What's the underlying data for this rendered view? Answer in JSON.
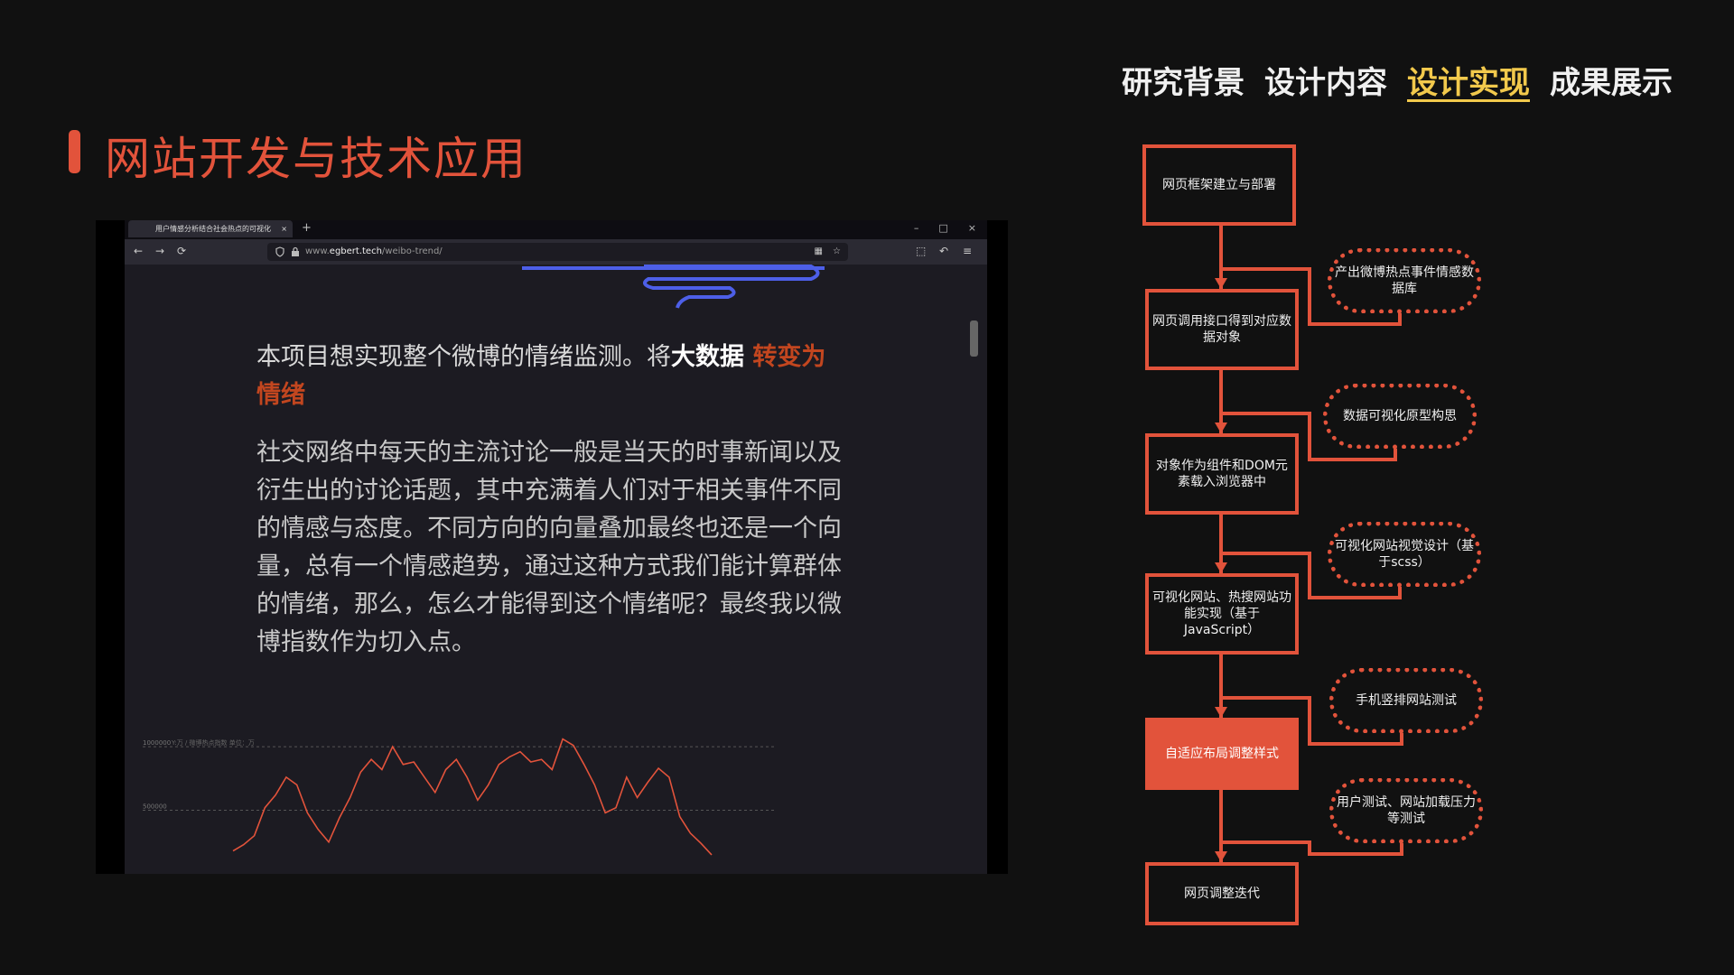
{
  "nav": [
    "研究背景",
    "设计内容",
    "设计实现",
    "成果展示"
  ],
  "nav_active_index": 2,
  "accent_color": "#e2533b",
  "active_nav_color": "#f2c94c",
  "page_title": "网站开发与技术应用",
  "browser": {
    "tab_title": "用户情感分析结合社会热点的可视化",
    "tab_close": "×",
    "new_tab": "+",
    "window_controls": [
      "–",
      "□",
      "×"
    ],
    "nav_icons": [
      "←",
      "→",
      "⟳"
    ],
    "url_prefix": "www.",
    "url_domain": "egbert.tech",
    "url_path": "/weibo-trend/",
    "right_icons": [
      "▦",
      "☆",
      "⬚",
      "↶",
      "≡"
    ]
  },
  "article": {
    "lead_plain": "本项目想实现整个微博的情绪监测。将",
    "lead_bold": "大数据",
    "lead_hot": " 转变为情绪",
    "body": "社交网络中每天的主流讨论一般是当天的时事新闻以及衍生出的讨论话题，其中充满着人们对于相关事件不同的情感与态度。不同方向的向量叠加最终也还是一个向量，总有一个情感趋势，通过这种方式我们能计算群体的情绪，那么，怎么才能得到这个情绪呢？最终我以微博指数作为切入点。"
  },
  "chart_data": {
    "type": "line",
    "title": "",
    "ylabel": "",
    "y_tick_labels": [
      "1000000",
      "500000"
    ],
    "y_series_label": "Y:万 / 微博热点指数 单位：万",
    "values": [
      180000,
      230000,
      300000,
      520000,
      620000,
      760000,
      700000,
      480000,
      350000,
      250000,
      440000,
      600000,
      800000,
      900000,
      820000,
      1000000,
      860000,
      880000,
      760000,
      640000,
      820000,
      900000,
      760000,
      580000,
      700000,
      860000,
      920000,
      960000,
      880000,
      900000,
      820000,
      1060000,
      1010000,
      860000,
      700000,
      480000,
      520000,
      760000,
      600000,
      720000,
      830000,
      760000,
      450000,
      320000,
      240000,
      150000
    ],
    "ylim": [
      0,
      1100000
    ],
    "grid": true
  },
  "flow": {
    "steps": [
      "网页框架建立与部署",
      "网页调用接口得到对应数据对象",
      "对象作为组件和DOM元素载入浏览器中",
      "可视化网站、热搜网站功能实现（基于JavaScript）",
      "自适应布局调整样式",
      "网页调整迭代"
    ],
    "side_notes": [
      "产出微博热点事件情感数据库",
      "数据可视化原型构思",
      "可视化网站视觉设计（基于scss）",
      "手机竖排网站测试",
      "用户测试、网站加载压力等测试"
    ]
  }
}
